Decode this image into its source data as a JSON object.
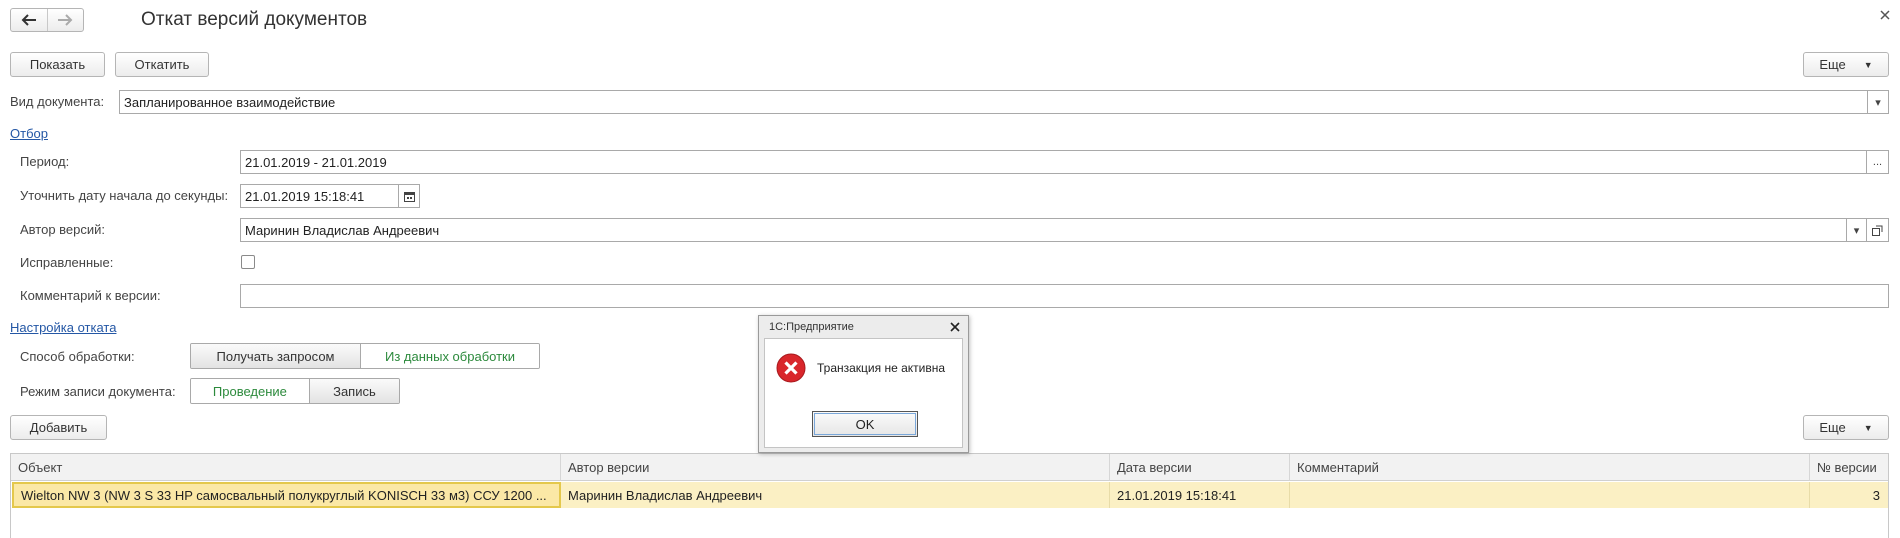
{
  "window": {
    "title": "Откат версий документов"
  },
  "nav": {
    "back_icon": "arrow-left-icon",
    "forward_icon": "arrow-right-icon"
  },
  "toolbar": {
    "show_label": "Показать",
    "rollback_label": "Откатить",
    "more_label": "Еще"
  },
  "doc_type": {
    "label": "Вид документа:",
    "value": "Запланированное взаимодействие"
  },
  "filter": {
    "link": "Отбор",
    "period_label": "Период:",
    "period_value": "21.01.2019 - 21.01.2019",
    "start_label": "Уточнить дату начала до секунды:",
    "start_value": "21.01.2019 15:18:41",
    "author_label": "Автор версий:",
    "author_value": "Маринин Владислав Андреевич",
    "corrected_label": "Исправленные:",
    "comment_label": "Комментарий к версии:",
    "comment_value": ""
  },
  "rollback": {
    "link": "Настройка отката",
    "method_label": "Способ обработки:",
    "method_options": [
      "Получать запросом",
      "Из данных обработки"
    ],
    "mode_label": "Режим записи документа:",
    "mode_options": [
      "Проведение",
      "Запись"
    ]
  },
  "table_toolbar": {
    "add_label": "Добавить",
    "more_label": "Еще"
  },
  "table": {
    "columns": [
      "Объект",
      "Автор версии",
      "Дата версии",
      "Комментарий",
      "№ версии"
    ],
    "rows": [
      [
        "Wielton NW 3 (NW 3 S 33 HP самосвальный полукруглый KONISCH 33 м3) ССУ 1200  ...",
        "Маринин Владислав Андреевич",
        "21.01.2019 15:18:41",
        "",
        "3"
      ]
    ]
  },
  "dialog": {
    "title": "1С:Предприятие",
    "message": "Транзакция не активна",
    "ok_label": "OK",
    "icon": "error-icon"
  }
}
